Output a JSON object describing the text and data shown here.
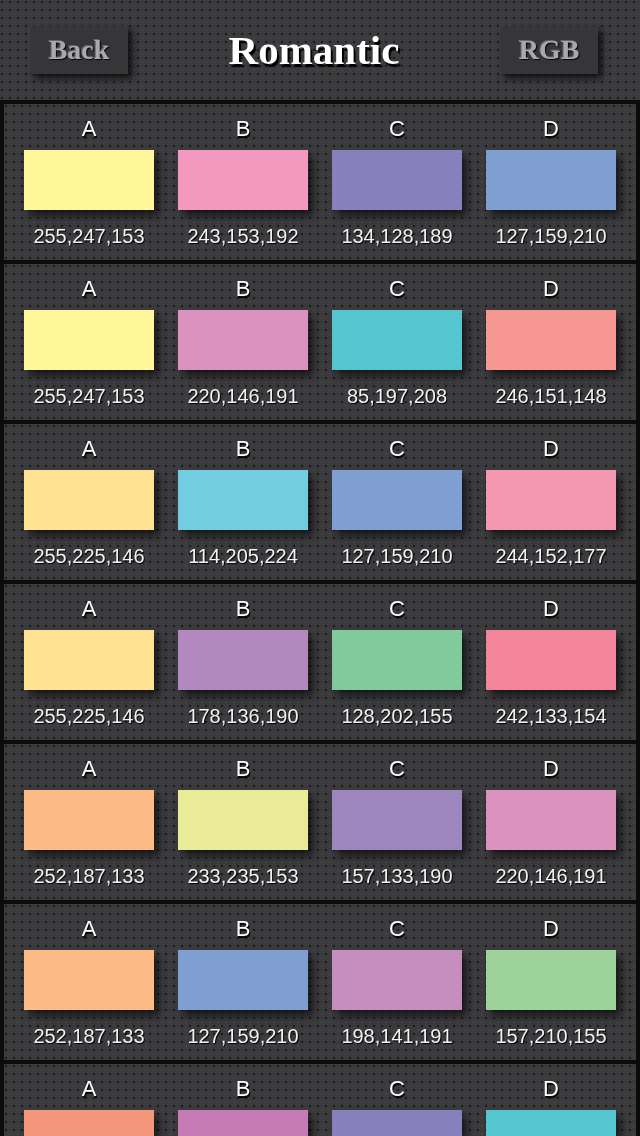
{
  "header": {
    "back_button": "Back",
    "title": "Romantic",
    "rgb_button": "RGB"
  },
  "palettes": [
    {
      "swatches": [
        {
          "label": "A",
          "color": "#fff799",
          "rgb": "255,247,153"
        },
        {
          "label": "B",
          "color": "#f399c0",
          "rgb": "243,153,192"
        },
        {
          "label": "C",
          "color": "#8680bd",
          "rgb": "134,128,189"
        },
        {
          "label": "D",
          "color": "#7f9fd2",
          "rgb": "127,159,210"
        }
      ]
    },
    {
      "swatches": [
        {
          "label": "A",
          "color": "#fff799",
          "rgb": "255,247,153"
        },
        {
          "label": "B",
          "color": "#dc92bf",
          "rgb": "220,146,191"
        },
        {
          "label": "C",
          "color": "#55c5d0",
          "rgb": "85,197,208"
        },
        {
          "label": "D",
          "color": "#f69794",
          "rgb": "246,151,148"
        }
      ]
    },
    {
      "swatches": [
        {
          "label": "A",
          "color": "#ffe192",
          "rgb": "255,225,146"
        },
        {
          "label": "B",
          "color": "#72cde0",
          "rgb": "114,205,224"
        },
        {
          "label": "C",
          "color": "#7f9fd2",
          "rgb": "127,159,210"
        },
        {
          "label": "D",
          "color": "#f498b1",
          "rgb": "244,152,177"
        }
      ]
    },
    {
      "swatches": [
        {
          "label": "A",
          "color": "#ffe192",
          "rgb": "255,225,146"
        },
        {
          "label": "B",
          "color": "#b288be",
          "rgb": "178,136,190"
        },
        {
          "label": "C",
          "color": "#80ca9b",
          "rgb": "128,202,155"
        },
        {
          "label": "D",
          "color": "#f2859a",
          "rgb": "242,133,154"
        }
      ]
    },
    {
      "swatches": [
        {
          "label": "A",
          "color": "#fcbb85",
          "rgb": "252,187,133"
        },
        {
          "label": "B",
          "color": "#e9eb99",
          "rgb": "233,235,153"
        },
        {
          "label": "C",
          "color": "#9d85be",
          "rgb": "157,133,190"
        },
        {
          "label": "D",
          "color": "#dc92bf",
          "rgb": "220,146,191"
        }
      ]
    },
    {
      "swatches": [
        {
          "label": "A",
          "color": "#fcbb85",
          "rgb": "252,187,133"
        },
        {
          "label": "B",
          "color": "#7f9fd2",
          "rgb": "127,159,210"
        },
        {
          "label": "C",
          "color": "#c68dbf",
          "rgb": "198,141,191"
        },
        {
          "label": "D",
          "color": "#9dd29b",
          "rgb": "157,210,155"
        }
      ]
    },
    {
      "swatches": [
        {
          "label": "A",
          "color": "#f4967a"
        },
        {
          "label": "B",
          "color": "#c77bb6"
        },
        {
          "label": "C",
          "color": "#8680bd"
        },
        {
          "label": "D",
          "color": "#55c5d0"
        }
      ]
    }
  ]
}
